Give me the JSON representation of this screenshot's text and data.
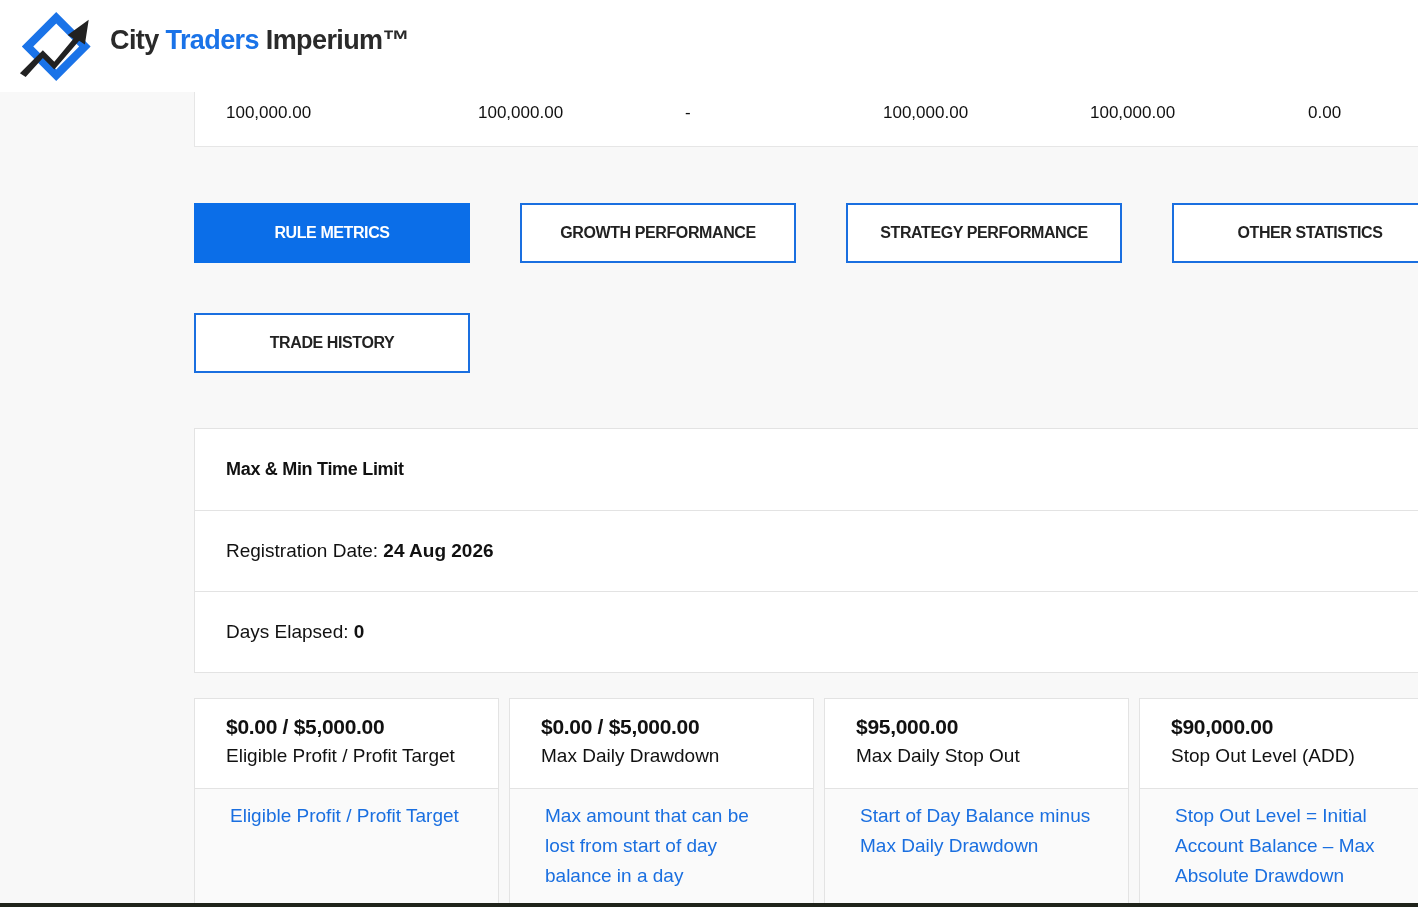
{
  "brand": {
    "parts": [
      {
        "text": "City",
        "highlight": false
      },
      {
        "text": "Traders",
        "highlight": true
      },
      {
        "text": "Imperium™",
        "highlight": false
      }
    ]
  },
  "account_stats": [
    "100,000.00",
    "100,000.00",
    "-",
    "100,000.00",
    "100,000.00",
    "0.00"
  ],
  "tabs": [
    {
      "label": "RULE METRICS",
      "selected": true
    },
    {
      "label": "GROWTH PERFORMANCE",
      "selected": false
    },
    {
      "label": "STRATEGY PERFORMANCE",
      "selected": false
    },
    {
      "label": "OTHER STATISTICS",
      "selected": false
    },
    {
      "label": "TRADE HISTORY",
      "selected": false
    }
  ],
  "time_limit": {
    "title": "Max & Min Time Limit",
    "rows": [
      "Registration Date: **24 Aug 2026**",
      "Days Elapsed: **0**"
    ]
  },
  "metric_cards": [
    {
      "value": "$0.00 / $5,000.00",
      "label": "Eligible Profit / Profit Target",
      "description": "Eligible Profit / Profit Target"
    },
    {
      "value": "$0.00 / $5,000.00",
      "label": "Max Daily Drawdown",
      "description": "Max amount that can be lost from start of day balance in a day"
    },
    {
      "value": "$95,000.00",
      "label": "Max Daily Stop Out",
      "description": "Start of Day Balance minus Max Daily Drawdown"
    },
    {
      "value": "$90,000.00",
      "label": "Stop Out Level (ADD)",
      "description": "Stop Out Level = Initial Account Balance – Max Absolute Drawdown"
    }
  ]
}
